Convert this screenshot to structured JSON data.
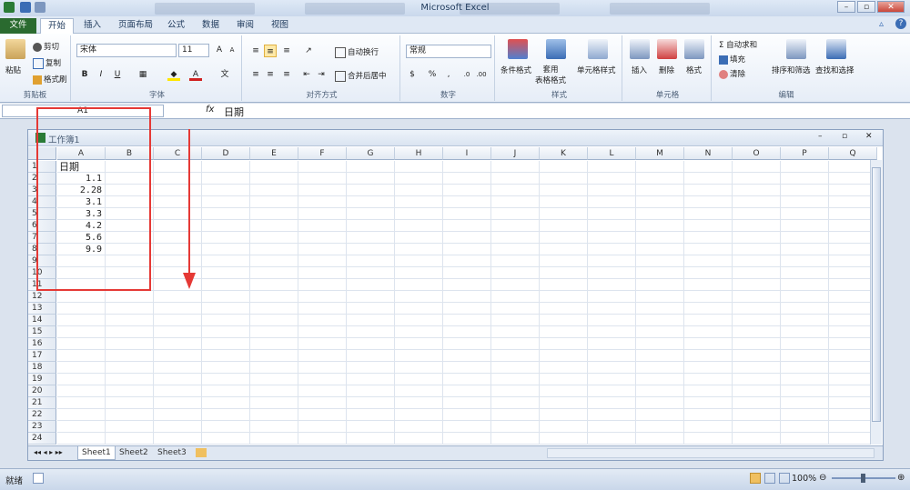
{
  "window": {
    "title": "Microsoft Excel"
  },
  "colors": {
    "file_tab": "#2a6a2f",
    "annotation": "#e53935"
  },
  "ribbon_tabs": [
    "文件",
    "开始",
    "插入",
    "页面布局",
    "公式",
    "数据",
    "审阅",
    "视图"
  ],
  "clipboard": {
    "paste": "粘贴",
    "cut": "剪切",
    "copy": "复制",
    "format_painter": "格式刷",
    "label": "剪贴板"
  },
  "font": {
    "name": "宋体",
    "size": "11",
    "label": "字体"
  },
  "alignment": {
    "wrap": "自动换行",
    "merge": "合并后居中",
    "label": "对齐方式"
  },
  "number": {
    "format": "常规",
    "label": "数字"
  },
  "styles": {
    "cond": "条件格式",
    "table_fmt": "套用\n表格格式",
    "cell_styles": "单元格样式",
    "label": "样式"
  },
  "cells": {
    "insert": "插入",
    "delete": "删除",
    "format": "格式",
    "label": "单元格"
  },
  "editing": {
    "autosum": "自动求和",
    "fill": "填充",
    "clear": "清除",
    "sort": "排序和筛选",
    "find": "查找和选择",
    "label": "编辑"
  },
  "formula_bar": {
    "name_box": "A1",
    "fx": "fx",
    "content": "日期"
  },
  "workbook": {
    "title": "工作簿1"
  },
  "columns": [
    "A",
    "B",
    "C",
    "D",
    "E",
    "F",
    "G",
    "H",
    "I",
    "J",
    "K",
    "L",
    "M",
    "N",
    "O",
    "P",
    "Q"
  ],
  "rows": [
    "1",
    "2",
    "3",
    "4",
    "5",
    "6",
    "7",
    "8",
    "9",
    "10",
    "11",
    "12",
    "13",
    "14",
    "15",
    "16",
    "17",
    "18",
    "19",
    "20",
    "21",
    "22",
    "23",
    "24"
  ],
  "cells_data": {
    "a1": "日期",
    "values": [
      "1.1",
      "2.28",
      "3.1",
      "3.3",
      "4.2",
      "5.6",
      "9.9"
    ]
  },
  "sheets": [
    "Sheet1",
    "Sheet2",
    "Sheet3"
  ],
  "status": {
    "ready": "就绪",
    "zoom": "100%"
  }
}
